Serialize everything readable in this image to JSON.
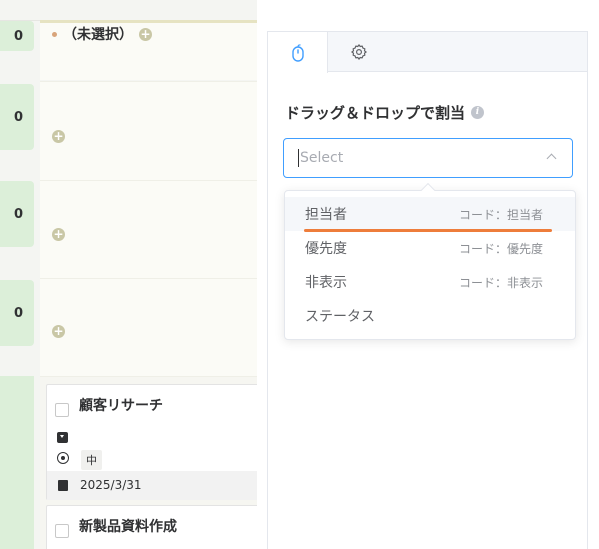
{
  "board": {
    "lanes": [
      {
        "count": "0",
        "title": "（未選択）"
      },
      {
        "count": "0"
      },
      {
        "count": "0"
      },
      {
        "count": "0"
      }
    ],
    "cards": [
      {
        "title": "顧客リサーチ",
        "priority": "中",
        "date": "2025/3/31"
      },
      {
        "title": "新製品資料作成"
      }
    ]
  },
  "panel": {
    "tabs": [
      {
        "icon": "mouse-icon",
        "active": true
      },
      {
        "icon": "gear-icon",
        "active": false
      }
    ],
    "section_title": "ドラッグ＆ドロップで割当",
    "info_icon_glyph": "i",
    "select": {
      "placeholder": "Select",
      "value": ""
    },
    "options": [
      {
        "label": "担当者",
        "code": "コード：担当者"
      },
      {
        "label": "優先度",
        "code": "コード：優先度"
      },
      {
        "label": "非表示",
        "code": "コード：非表示"
      },
      {
        "label": "ステータス",
        "code": ""
      }
    ],
    "colors": {
      "accent": "#409eff",
      "highlight_underline": "#ee7d3b",
      "count_badge": "#dcefd9"
    }
  }
}
